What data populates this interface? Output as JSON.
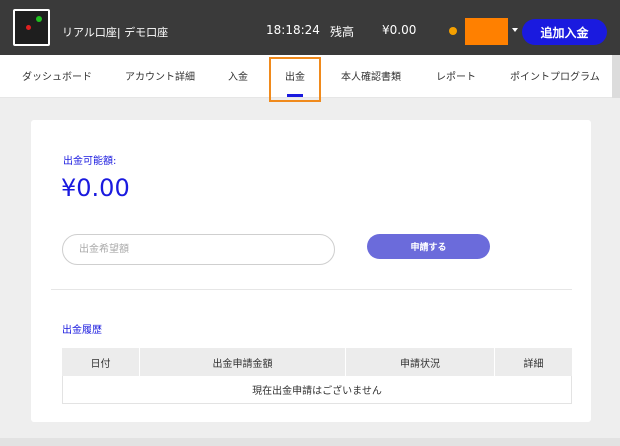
{
  "header": {
    "account_text": "リアル口座| デモ口座",
    "time": "18:18:24",
    "balance_label": "残高",
    "balance_value": "¥0.00",
    "deposit_button": "追加入金",
    "colors": {
      "bar": "#3a3a3a",
      "accent": "#1a1adf",
      "status_dot": "#f5a000",
      "avatar": "#ff8000"
    }
  },
  "nav": {
    "items": [
      {
        "label": "ダッシュボード"
      },
      {
        "label": "アカウント詳細"
      },
      {
        "label": "入金"
      },
      {
        "label": "出金"
      },
      {
        "label": "本人確認書類"
      },
      {
        "label": "レポート"
      },
      {
        "label": "ポイントプログラム"
      }
    ],
    "active_label": "出金",
    "highlight_color": "#f08a1c"
  },
  "withdraw": {
    "available_label": "出金可能額:",
    "available_value": "¥0.00",
    "amount_placeholder": "出金希望額",
    "amount_value": "",
    "request_button": "申請する"
  },
  "history": {
    "title": "出金履歴",
    "columns": [
      "日付",
      "出金申請金額",
      "申請状況",
      "詳細"
    ],
    "empty_message": "現在出金申請はございません"
  }
}
